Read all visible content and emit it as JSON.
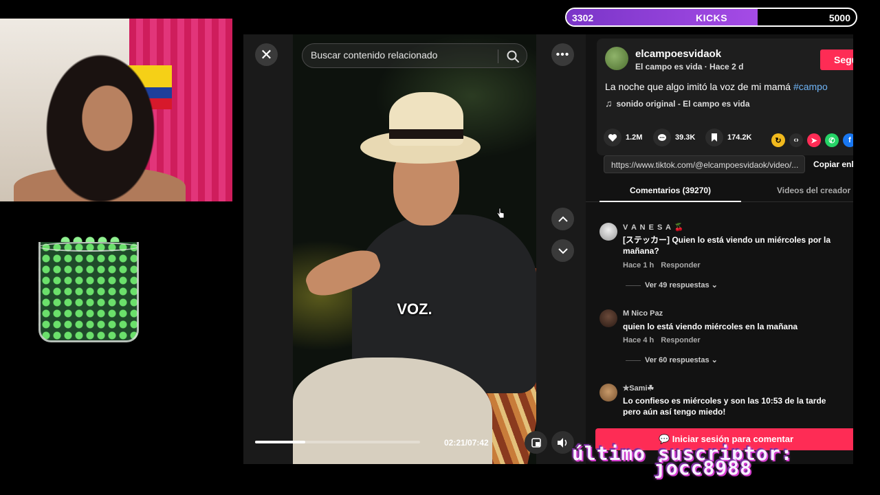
{
  "overlay": {
    "kicks": {
      "current": "3302",
      "label": "KICKS",
      "goal": "5000",
      "progress": 0.66
    },
    "last_subscriber_label": "último suscriptor:",
    "last_subscriber_name": "jocc8988"
  },
  "player": {
    "search_placeholder": "Buscar contenido relacionado",
    "caption": "VOZ.",
    "time": "02:21/07:42",
    "progress": 0.306
  },
  "post": {
    "author": "elcampoesvidaok",
    "author_sub": "El campo es vida · Hace 2 d",
    "follow_label": "Seguir",
    "description": "La noche que algo imitó la voz de mi mamá ",
    "hashtag": "#campo",
    "sound": "sonido original - El campo es vida",
    "likes": "1.2M",
    "comments_count": "39.3K",
    "saves": "174.2K",
    "link": "https://www.tiktok.com/@elcampoesvidaok/video/...",
    "copy_link": "Copiar enlace"
  },
  "tabs": {
    "comments": "Comentarios (39270)",
    "creator_videos": "Videos del creador"
  },
  "comments": [
    {
      "user": "V A N E S A 🍒",
      "text": "[ステッカー] Quien lo está viendo un miércoles por la mañana?",
      "time": "Hace 1 h",
      "reply": "Responder",
      "replies": "Ver 49 respuestas ⌄"
    },
    {
      "user": "M Nico Paz",
      "text": "quien lo está viendo miércoles en la mañana",
      "time": "Hace 4 h",
      "reply": "Responder",
      "replies": "Ver 60 respuestas ⌄"
    },
    {
      "user": "✮Sami☘︎",
      "text": "Lo confieso es miércoles y son las 10:53 de la tarde pero aún así tengo miedo!",
      "time": "",
      "reply": "",
      "replies": ""
    }
  ],
  "login_comment": "Iniciar sesión para comentar",
  "colors": {
    "accent": "#fe2c55",
    "hashtag": "#6fb4f6",
    "kicks": "#a54be6"
  }
}
